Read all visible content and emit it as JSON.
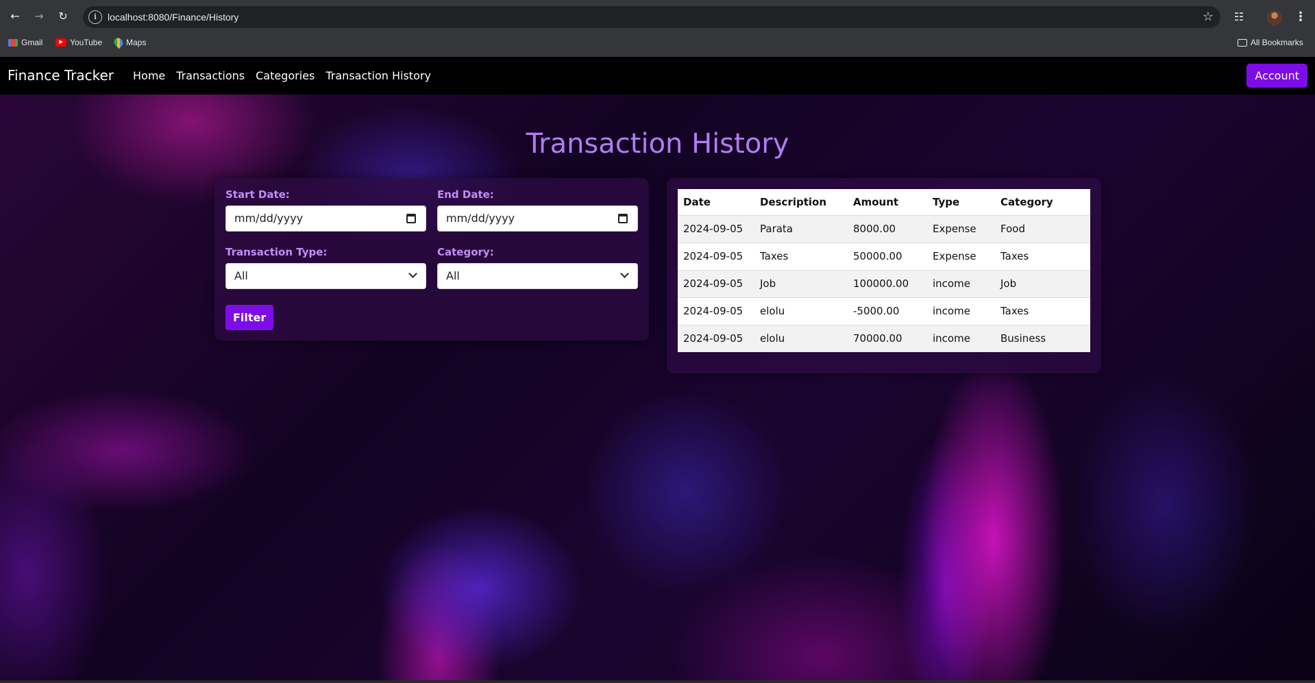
{
  "browser": {
    "url": "localhost:8080/Finance/History",
    "bookmarks": [
      {
        "label": "Gmail",
        "icon": "gmail-icon"
      },
      {
        "label": "YouTube",
        "icon": "youtube-icon"
      },
      {
        "label": "Maps",
        "icon": "maps-icon"
      }
    ],
    "all_bookmarks": "All Bookmarks"
  },
  "navbar": {
    "brand": "Finance Tracker",
    "links": [
      "Home",
      "Transactions",
      "Categories",
      "Transaction History"
    ],
    "account": "Account",
    "accent_color": "#7c0de6"
  },
  "page": {
    "title": "Transaction History",
    "title_color": "#b27cf3"
  },
  "filters": {
    "start_date_label": "Start Date:",
    "start_date_placeholder": "mm/dd/yyyy",
    "end_date_label": "End Date:",
    "end_date_placeholder": "mm/dd/yyyy",
    "type_label": "Transaction Type:",
    "type_value": "All",
    "category_label": "Category:",
    "category_value": "All",
    "filter_button": "Filter"
  },
  "table": {
    "headers": [
      "Date",
      "Description",
      "Amount",
      "Type",
      "Category"
    ],
    "rows": [
      [
        "2024-09-05",
        "Parata",
        "8000.00",
        "Expense",
        "Food"
      ],
      [
        "2024-09-05",
        "Taxes",
        "50000.00",
        "Expense",
        "Taxes"
      ],
      [
        "2024-09-05",
        "Job",
        "100000.00",
        "income",
        "Job"
      ],
      [
        "2024-09-05",
        "elolu",
        "-5000.00",
        "income",
        "Taxes"
      ],
      [
        "2024-09-05",
        "elolu",
        "70000.00",
        "income",
        "Business"
      ]
    ]
  }
}
